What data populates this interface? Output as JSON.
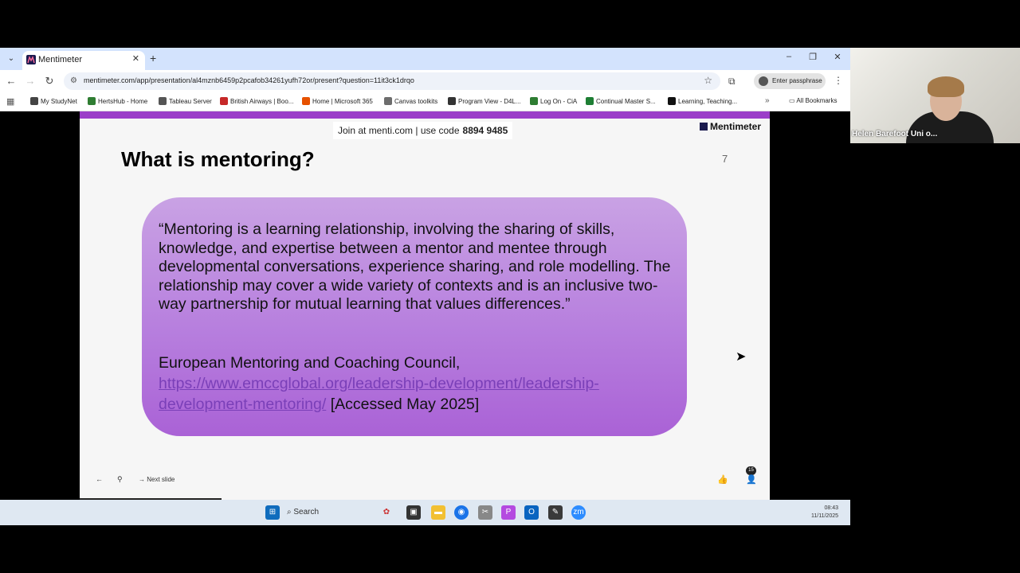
{
  "browser": {
    "tab": {
      "title": "Mentimeter"
    },
    "url": "mentimeter.com/app/presentation/al4mznb6459p2pcafob34261yufh72or/present?question=11it3ck1drqo",
    "passphrase_label": "Enter passphrase",
    "bookmarks": [
      {
        "label": "My StudyNet",
        "color": "#444444"
      },
      {
        "label": "HertsHub - Home",
        "color": "#2f7d32"
      },
      {
        "label": "Tableau Server",
        "color": "#555555"
      },
      {
        "label": "British Airways | Boo...",
        "color": "#c62828"
      },
      {
        "label": "Home | Microsoft 365",
        "color": "#e65100"
      },
      {
        "label": "Canvas toolkits",
        "color": "#6d6d6d"
      },
      {
        "label": "Program View - D4L...",
        "color": "#333333"
      },
      {
        "label": "Log On - CiA",
        "color": "#2e7d32"
      },
      {
        "label": "Continual Master S...",
        "color": "#1e7e34"
      },
      {
        "label": "Learning, Teaching...",
        "color": "#111111"
      }
    ],
    "all_bookmarks_label": "All Bookmarks"
  },
  "slide": {
    "join_text": "Join at menti.com | use code",
    "join_code": "8894 9485",
    "logo_text": "Mentimeter",
    "title": "What is mentoring?",
    "number": "7",
    "quote": "“Mentoring is a learning relationship, involving the sharing of skills, knowledge, and expertise between a mentor and mentee through developmental conversations, experience sharing, and role modelling. The relationship may cover a wide variety of contexts and is an inclusive two-way partnership for mutual learning that values differences.”",
    "attribution": "European Mentoring and Coaching Council,",
    "link": "https://www.emccglobal.org/leadership-development/leadership-development-mentoring/",
    "accessed": "[Accessed May 2025]",
    "accent_color": "#9b3ec8"
  },
  "controls": {
    "next_label": "Next slide",
    "audience_count": "15"
  },
  "taskbar": {
    "search_label": "Search",
    "time": "08:43",
    "date": "11/11/2025"
  },
  "webcam": {
    "name": "Helen Barefoot Uni o..."
  }
}
